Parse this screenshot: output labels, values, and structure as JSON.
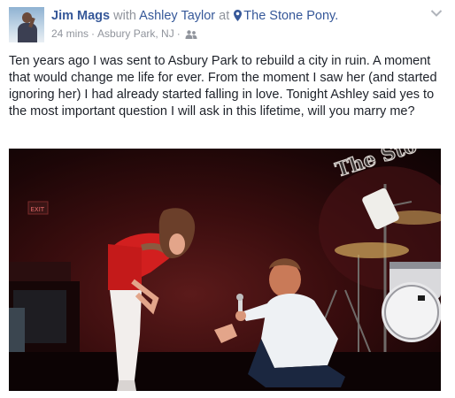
{
  "post": {
    "author": "Jim Mags",
    "with_word": "with",
    "tagged_person": "Ashley Taylor",
    "at_word": "at",
    "location": "The Stone Pony.",
    "time": "24 mins",
    "separator": "·",
    "place": "Asbury Park, NJ",
    "audience_icon": "friends-icon",
    "message": "Ten years ago I was sent to Asbury Park to rebuild a city in ruin. A moment that would change me life for ever. From the moment I saw her (and started ignoring her) I had already started falling in love. Tonight Ashley said yes to the most important question I will ask in this lifetime, will you marry me?",
    "photo": {
      "sign_text": "The Sto",
      "exit_sign": "EXIT"
    }
  },
  "colors": {
    "link": "#365899",
    "secondary_text": "#90949c",
    "body_text": "#1d2129"
  }
}
